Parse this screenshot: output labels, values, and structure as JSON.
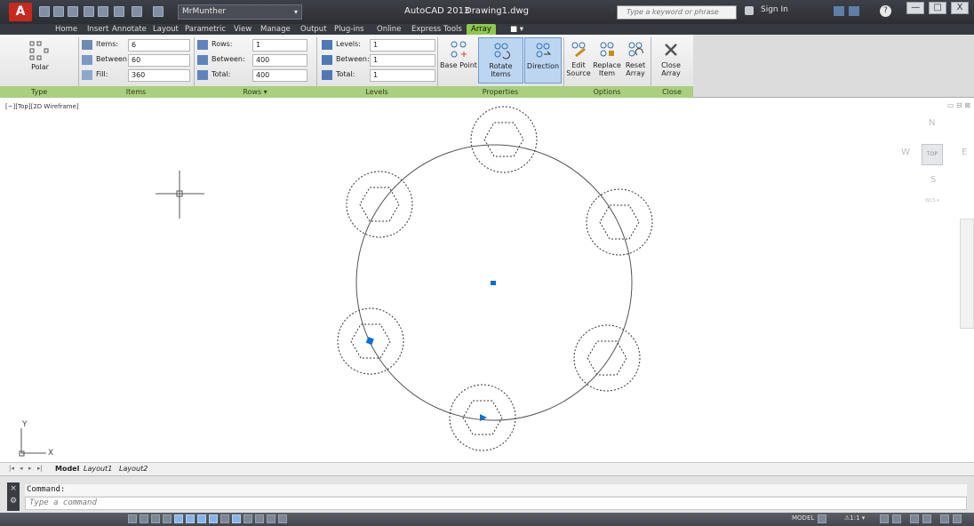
{
  "titlebar": {
    "app_logo": "A",
    "workspace": "MrMunther",
    "app_title": "AutoCAD 2013",
    "file_name": "Drawing1.dwg",
    "search_placeholder": "Type a keyword or phrase",
    "sign_in": "Sign In",
    "minimize": "—",
    "restore": "□",
    "close": "X"
  },
  "ribbon_tabs": [
    "Home",
    "Insert",
    "Annotate",
    "Layout",
    "Parametric",
    "View",
    "Manage",
    "Output",
    "Plug-ins",
    "Online",
    "Express Tools",
    "Array"
  ],
  "active_tab": "Array",
  "ribbon": {
    "type": {
      "button": "Polar",
      "panel": "Type"
    },
    "items": {
      "panel": "Items",
      "items_label": "Items:",
      "items_value": "6",
      "between_label": "Between:",
      "between_value": "60",
      "fill_label": "Fill:",
      "fill_value": "360"
    },
    "rows": {
      "panel": "Rows ▾",
      "rows_label": "Rows:",
      "rows_value": "1",
      "between_label": "Between:",
      "between_value": "400",
      "total_label": "Total:",
      "total_value": "400"
    },
    "levels": {
      "panel": "Levels",
      "levels_label": "Levels:",
      "levels_value": "1",
      "between_label": "Between:",
      "between_value": "1",
      "total_label": "Total:",
      "total_value": "1"
    },
    "properties": {
      "panel": "Properties",
      "base_point": "Base Point",
      "rotate_items": "Rotate Items",
      "direction": "Direction"
    },
    "options": {
      "panel": "Options",
      "edit_source_1": "Edit",
      "edit_source_2": "Source",
      "replace_item_1": "Replace",
      "replace_item_2": "Item",
      "reset_array_1": "Reset",
      "reset_array_2": "Array"
    },
    "close": {
      "panel": "Close",
      "close_array": "Close Array"
    }
  },
  "viewport": {
    "label": "[−][Top][2D Wireframe]",
    "ucs_x": "X",
    "ucs_y": "Y",
    "corner_controls": "▭ ⊟ ⊠"
  },
  "viewcube": {
    "north": "N",
    "south": "S",
    "east": "E",
    "west": "W",
    "top": "TOP",
    "wcs": "WCS ▾"
  },
  "layout_tabs": {
    "model": "Model",
    "layout1": "Layout1",
    "layout2": "Layout2"
  },
  "command": {
    "history": "Command:",
    "prompt_placeholder": "Type a command",
    "side_close": "×",
    "side_wrench": "⚙"
  },
  "statusbar": {
    "model": "MODEL",
    "scale": "⚠1:1 ▾"
  },
  "colors": {
    "ribbon_accent": "#8ec74d",
    "grip": "#0a6fd1",
    "titlebar": "#2c2e33"
  }
}
